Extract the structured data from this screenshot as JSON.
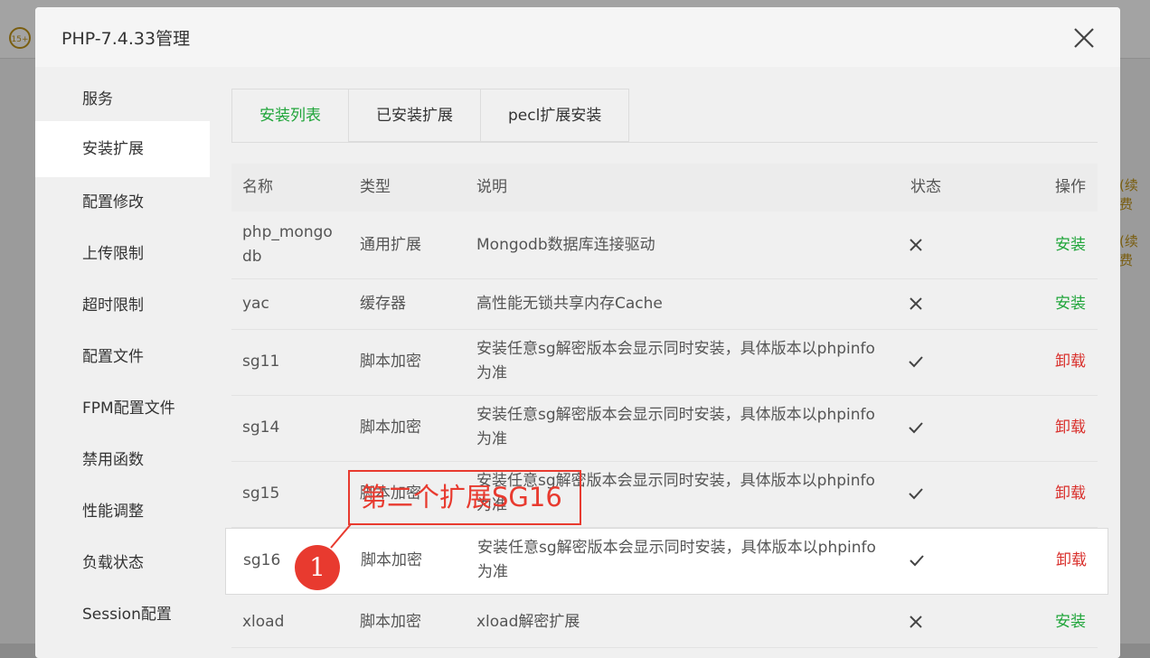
{
  "modal": {
    "title": "PHP-7.4.33管理"
  },
  "background": {
    "badge": "15+",
    "tag_1": "(续费",
    "tag_2": "(续费"
  },
  "sidebar": {
    "items": [
      {
        "label": "服务"
      },
      {
        "label": "安装扩展",
        "active": true
      },
      {
        "label": "配置修改"
      },
      {
        "label": "上传限制"
      },
      {
        "label": "超时限制"
      },
      {
        "label": "配置文件"
      },
      {
        "label": "FPM配置文件"
      },
      {
        "label": "禁用函数"
      },
      {
        "label": "性能调整"
      },
      {
        "label": "负载状态"
      },
      {
        "label": "Session配置"
      }
    ]
  },
  "tabs": [
    {
      "label": "安装列表",
      "active": true
    },
    {
      "label": "已安装扩展"
    },
    {
      "label": "pecl扩展安装"
    }
  ],
  "table": {
    "headers": {
      "name": "名称",
      "type": "类型",
      "desc": "说明",
      "status": "状态",
      "op": "操作"
    },
    "rows": [
      {
        "name": "php_mongodb",
        "type": "通用扩展",
        "desc": "Mongodb数据库连接驱动",
        "status": "x",
        "op": "安装"
      },
      {
        "name": "yac",
        "type": "缓存器",
        "desc": "高性能无锁共享内存Cache",
        "status": "x",
        "op": "安装"
      },
      {
        "name": "sg11",
        "type": "脚本加密",
        "desc": "安装任意sg解密版本会显示同时安装，具体版本以phpinfo为准",
        "status": "check",
        "op": "卸载"
      },
      {
        "name": "sg14",
        "type": "脚本加密",
        "desc": "安装任意sg解密版本会显示同时安装，具体版本以phpinfo为准",
        "status": "check",
        "op": "卸载"
      },
      {
        "name": "sg15",
        "type": "脚本加密",
        "desc": "安装任意sg解密版本会显示同时安装，具体版本以phpinfo为准",
        "status": "check",
        "op": "卸载"
      },
      {
        "name": "sg16",
        "type": "脚本加密",
        "desc": "安装任意sg解密版本会显示同时安装，具体版本以phpinfo为准",
        "status": "check",
        "op": "卸载"
      },
      {
        "name": "xload",
        "type": "脚本加密",
        "desc": "xload解密扩展",
        "status": "x",
        "op": "安装"
      }
    ]
  },
  "annotation": {
    "label": "第二个扩展SG16",
    "marker": "1",
    "color": "#e83a2f"
  },
  "colors": {
    "accent_green": "#20a53a",
    "danger_red": "#d9302c"
  }
}
